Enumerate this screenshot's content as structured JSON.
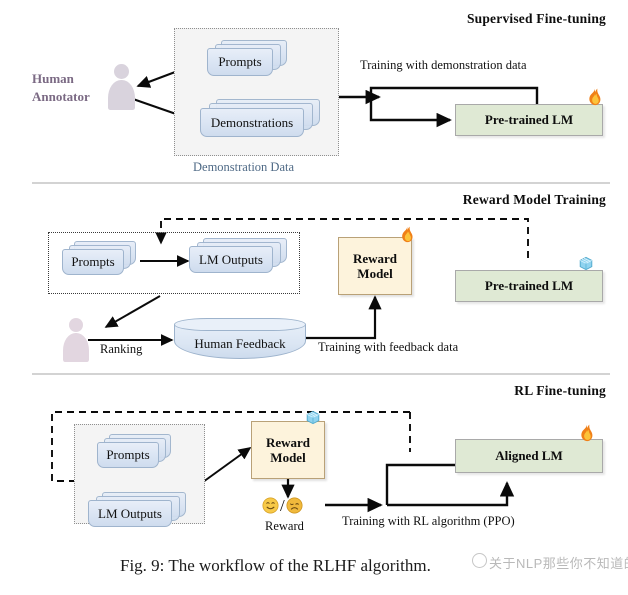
{
  "figure": {
    "caption": "Fig. 9: The workflow of the RLHF algorithm.",
    "watermark": "关于NLP那些你不知道的事"
  },
  "colors": {
    "lm_box": "#dfe9d4",
    "reward_box": "#fdf3dc",
    "document": "#dce6f4",
    "human_label": "#7b6a84",
    "dotted_label": "#4f6a86",
    "divider": "#b9b9b9"
  },
  "panels": [
    {
      "id": "supervised-fine-tuning",
      "title": "Supervised Fine-tuning",
      "human_label_line1": "Human",
      "human_label_line2": "Annotator",
      "group_caption": "Demonstration Data",
      "documents": [
        {
          "label": "Prompts"
        },
        {
          "label": "Demonstrations"
        }
      ],
      "edge_label": "Training with demonstration data",
      "model": {
        "label": "Pre-trained LM",
        "state_icon": "flame-icon"
      }
    },
    {
      "id": "reward-model-training",
      "title": "Reward Model Training",
      "documents": [
        {
          "label": "Prompts"
        },
        {
          "label": "LM Outputs"
        }
      ],
      "ranking_label": "Ranking",
      "feedback_store": "Human Feedback",
      "edge_label": "Training with feedback data",
      "reward_model": {
        "line1": "Reward",
        "line2": "Model",
        "state_icon": "flame-icon"
      },
      "model": {
        "label": "Pre-trained LM",
        "state_icon": "snowflake-icon"
      }
    },
    {
      "id": "rl-fine-tuning",
      "title": "RL Fine-tuning",
      "documents": [
        {
          "label": "Prompts"
        },
        {
          "label": "LM Outputs"
        }
      ],
      "reward_model": {
        "line1": "Reward",
        "line2": "Model",
        "state_icon": "snowflake-icon"
      },
      "reward_signal": {
        "label": "Reward",
        "positive_icon": "smiling-face-icon",
        "separator": "/",
        "negative_icon": "frowning-face-icon"
      },
      "edge_label": "Training with RL algorithm (PPO)",
      "model": {
        "label": "Aligned LM",
        "state_icon": "flame-icon"
      }
    }
  ]
}
